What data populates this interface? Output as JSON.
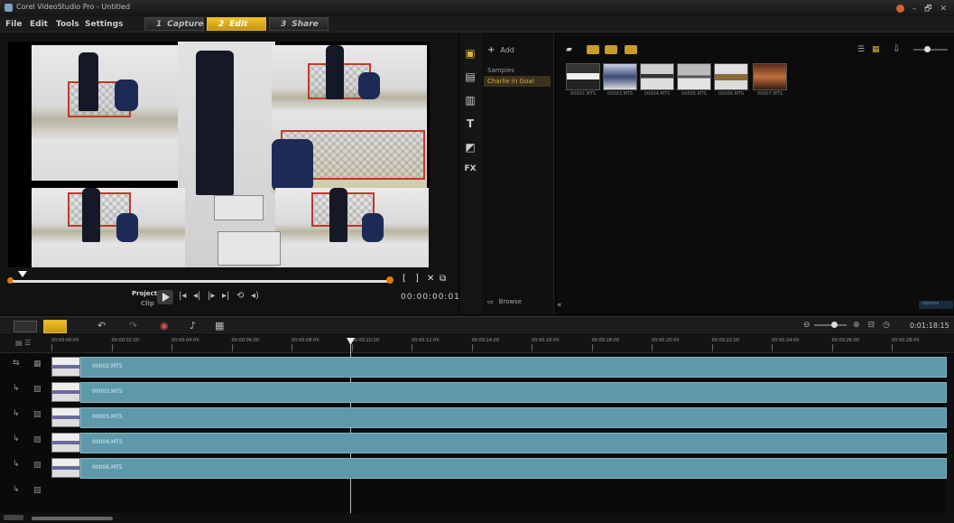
{
  "window": {
    "title": "Corel VideoStudio Pro - Untitled",
    "controls": [
      "–",
      "🗗",
      "✕"
    ]
  },
  "menu": {
    "items": [
      "File",
      "Edit",
      "Tools",
      "Settings"
    ]
  },
  "steps": [
    {
      "num": "1",
      "label": "Capture",
      "active": false
    },
    {
      "num": "2",
      "label": "Edit",
      "active": true
    },
    {
      "num": "3",
      "label": "Share",
      "active": false
    }
  ],
  "player": {
    "mode_project": "Project",
    "mode_clip": "Clip",
    "mark_in": "[",
    "mark_out": "]",
    "timecode": "00:00:00:01",
    "transport_icons": [
      "play-icon",
      "home-icon",
      "prev-frame-icon",
      "next-frame-icon",
      "end-icon",
      "repeat-icon",
      "volume-icon"
    ]
  },
  "library": {
    "add_label": "Add",
    "folders": [
      {
        "label": "Samples",
        "selected": false
      },
      {
        "label": "Charlie in Goal",
        "selected": true
      }
    ],
    "browse_label": "Browse",
    "options_label": "Options",
    "thumbnails": [
      "00002.MTS",
      "00003.MTS",
      "00004.MTS",
      "00005.MTS",
      "00006.MTS",
      "00007.MTS"
    ],
    "tool_icons": [
      "media-icon",
      "instant-project-icon",
      "transition-icon",
      "title-icon",
      "graphic-icon",
      "filter-icon"
    ],
    "filter_label": "FX",
    "title_label": "T"
  },
  "timeline": {
    "duration": "0:01:18:15",
    "ruler": [
      "00:00:00:00",
      "00:00:02:00",
      "00:00:04:00",
      "00:00:06:00",
      "00:00:08:00",
      "00:00:10:00",
      "00:00:12:00",
      "00:00:14:00",
      "00:00:16:00",
      "00:00:18:00",
      "00:00:20:00",
      "00:00:22:00",
      "00:00:24:00",
      "00:00:26:00",
      "00:00:28:00"
    ],
    "tracks": [
      {
        "clip": "00002.MTS"
      },
      {
        "clip": "00003.MTS"
      },
      {
        "clip": "00005.MTS"
      },
      {
        "clip": "00004.MTS"
      },
      {
        "clip": "00006.MTS"
      }
    ]
  }
}
